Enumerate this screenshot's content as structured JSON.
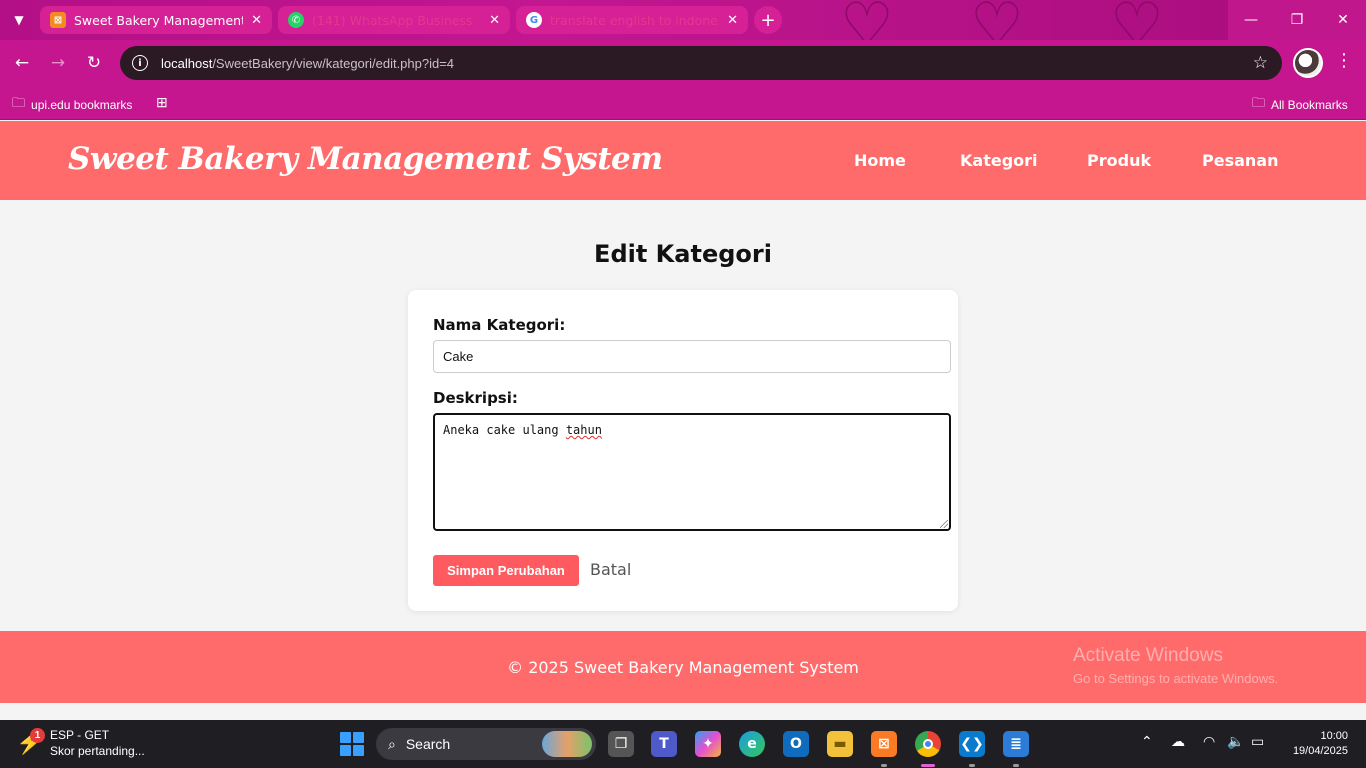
{
  "browser": {
    "tabs": [
      {
        "title": "Sweet Bakery Management Syst",
        "state": "active"
      },
      {
        "title": "(141) WhatsApp Business",
        "state": "inactive"
      },
      {
        "title": "translate english to indonesia",
        "state": "inactive"
      }
    ],
    "url_host": "localhost",
    "url_path": "/SweetBakery/view/kategori/edit.php?id=4",
    "bookmarks": {
      "left": "upi.edu bookmarks",
      "right": "All Bookmarks"
    },
    "accent": "#c5168f"
  },
  "site": {
    "logo": "Sweet Bakery Management System",
    "nav": [
      "Home",
      "Kategori",
      "Produk",
      "Pesanan"
    ],
    "brand_color": "#ff6b6b"
  },
  "form": {
    "title": "Edit Kategori",
    "name_label": "Nama Kategori:",
    "name_value": "Cake",
    "desc_label": "Deskripsi:",
    "desc_value_plain": "Aneka cake ulang ",
    "desc_value_misspelled": "tahun",
    "save_label": "Simpan Perubahan",
    "cancel_label": "Batal"
  },
  "footer": {
    "copyright": "© 2025 Sweet Bakery Management System",
    "watermark_title": "Activate Windows",
    "watermark_sub": "Go to Settings to activate Windows."
  },
  "taskbar": {
    "widget_badge": "1",
    "widget_title": "ESP - GET",
    "widget_sub": "Skor pertanding...",
    "search_label": "Search",
    "time": "10:00",
    "date": "19/04/2025"
  }
}
